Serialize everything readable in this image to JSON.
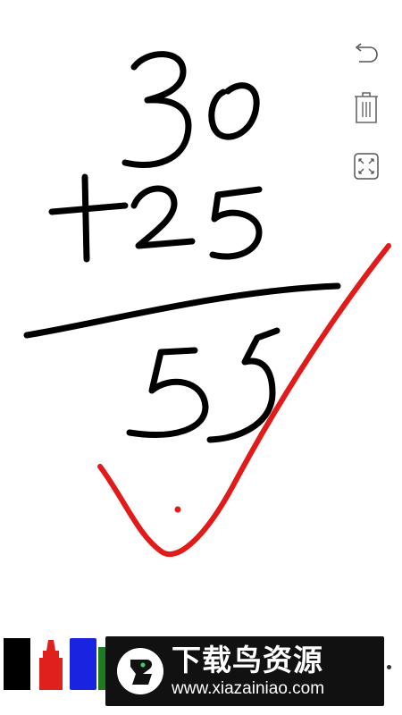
{
  "toolbar": {
    "undo_icon": "undo-icon",
    "delete_icon": "trash-icon",
    "fullscreen_icon": "expand-icon"
  },
  "canvas": {
    "handwriting": [
      "30",
      "+25",
      "55"
    ],
    "check_mark_color": "#e11a1a",
    "ink_color": "#000000"
  },
  "pens": [
    {
      "name": "black-marker",
      "color": "#000000"
    },
    {
      "name": "red-marker",
      "color": "#e0201c"
    },
    {
      "name": "blue-marker",
      "color": "#1a23e0"
    },
    {
      "name": "green-marker",
      "color": "#1f7a22"
    }
  ],
  "watermark": {
    "title": "下载鸟资源",
    "url": "www.xiazainiao.com"
  }
}
